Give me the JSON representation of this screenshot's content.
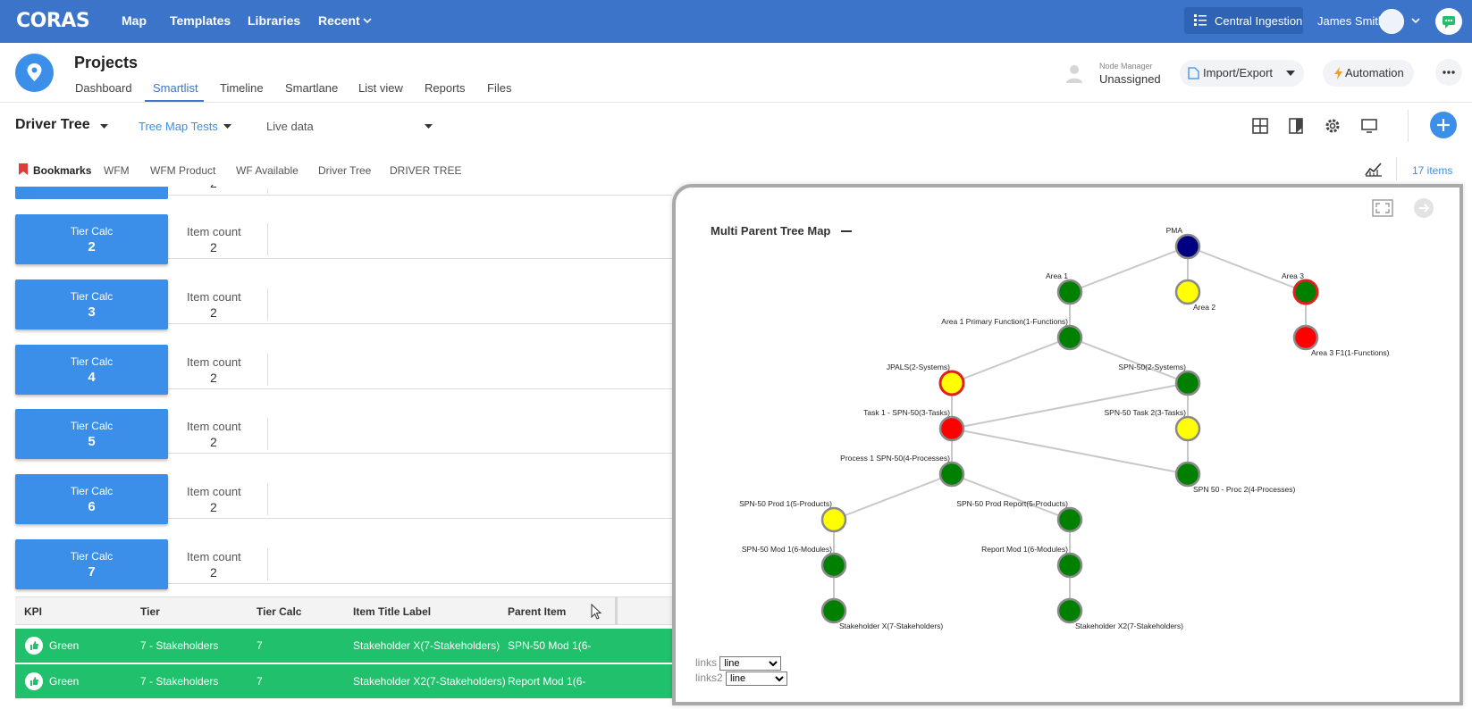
{
  "topbar": {
    "logo": "CORAS",
    "nav": [
      "Map",
      "Templates",
      "Libraries",
      "Recent"
    ],
    "central": "Central Ingestion",
    "user": "James Smith"
  },
  "project": {
    "title": "Projects",
    "tabs": [
      "Dashboard",
      "Smartlist",
      "Timeline",
      "Smartlane",
      "List view",
      "Reports",
      "Files"
    ],
    "active_tab": "Smartlist",
    "node_manager_label": "Node Manager",
    "node_manager_value": "Unassigned",
    "import_export": "Import/Export",
    "automation": "Automation"
  },
  "toolbar": {
    "view": "Driver Tree",
    "filter": "Tree Map Tests",
    "data_mode": "Live data"
  },
  "bookmarks": {
    "label": "Bookmarks",
    "items": [
      "WFM",
      "WFM Product",
      "WF Available",
      "Driver Tree",
      "DRIVER TREE"
    ],
    "count": "17 items"
  },
  "tiers": [
    {
      "label": "Tier Calc",
      "value": "2",
      "count_label": "Item count",
      "count": "2"
    },
    {
      "label": "Tier Calc",
      "value": "3",
      "count_label": "Item count",
      "count": "2"
    },
    {
      "label": "Tier Calc",
      "value": "4",
      "count_label": "Item count",
      "count": "2"
    },
    {
      "label": "Tier Calc",
      "value": "5",
      "count_label": "Item count",
      "count": "2"
    },
    {
      "label": "Tier Calc",
      "value": "6",
      "count_label": "Item count",
      "count": "2"
    },
    {
      "label": "Tier Calc",
      "value": "7",
      "count_label": "Item count",
      "count": "2"
    }
  ],
  "partial_tier_count": "2",
  "table": {
    "headers": [
      "KPI",
      "Tier",
      "Tier Calc",
      "Item Title Label",
      "Parent Item"
    ],
    "rows": [
      [
        "Green",
        "7 - Stakeholders",
        "7",
        "Stakeholder X(7-Stakeholders)",
        "SPN-50 Mod 1(6-"
      ],
      [
        "Green",
        "7 - Stakeholders",
        "7",
        "Stakeholder X2(7-Stakeholders)",
        "Report Mod 1(6-"
      ]
    ],
    "row_color": "#21c06c"
  },
  "popup": {
    "title": "Multi Parent Tree Map",
    "links_label": "links",
    "links2_label": "links2",
    "links_options": [
      "line"
    ],
    "links_value": "line",
    "links2_value": "line"
  },
  "tree": {
    "colors": {
      "navy": "#000080",
      "green": "#008000",
      "yellow": "#ffff00",
      "red": "#ff0000"
    },
    "nodes": [
      {
        "id": "pma",
        "label": "PMA",
        "color": "navy",
        "ring": "grey"
      },
      {
        "id": "a1",
        "label": "Area 1",
        "color": "green",
        "ring": "grey"
      },
      {
        "id": "a2",
        "label": "Area 2",
        "color": "yellow",
        "ring": "grey"
      },
      {
        "id": "a3",
        "label": "Area 3",
        "color": "green",
        "ring": "red"
      },
      {
        "id": "a1pf",
        "label": "Area 1 Primary Function(1-Functions)",
        "color": "green",
        "ring": "grey"
      },
      {
        "id": "a3f1",
        "label": "Area 3 F1(1-Functions)",
        "color": "red",
        "ring": "grey"
      },
      {
        "id": "jpals",
        "label": "JPALS(2-Systems)",
        "color": "yellow",
        "ring": "red"
      },
      {
        "id": "spn50",
        "label": "SPN-50(2-Systems)",
        "color": "green",
        "ring": "grey"
      },
      {
        "id": "task1",
        "label": "Task 1 - SPN-50(3-Tasks)",
        "color": "red",
        "ring": "grey"
      },
      {
        "id": "task2",
        "label": "SPN-50 Task 2(3-Tasks)",
        "color": "yellow",
        "ring": "grey"
      },
      {
        "id": "proc1",
        "label": "Process 1 SPN-50(4-Processes)",
        "color": "green",
        "ring": "grey"
      },
      {
        "id": "proc2",
        "label": "SPN 50 - Proc 2(4-Processes)",
        "color": "green",
        "ring": "grey"
      },
      {
        "id": "prod1",
        "label": "SPN-50 Prod 1(5-Products)",
        "color": "yellow",
        "ring": "grey"
      },
      {
        "id": "prodr",
        "label": "SPN-50 Prod Report(5-Products)",
        "color": "green",
        "ring": "grey"
      },
      {
        "id": "mod1",
        "label": "SPN-50 Mod 1(6-Modules)",
        "color": "green",
        "ring": "grey"
      },
      {
        "id": "rmod1",
        "label": "Report Mod 1(6-Modules)",
        "color": "green",
        "ring": "grey"
      },
      {
        "id": "shx",
        "label": "Stakeholder X(7-Stakeholders)",
        "color": "green",
        "ring": "grey"
      },
      {
        "id": "shx2",
        "label": "Stakeholder X2(7-Stakeholders)",
        "color": "green",
        "ring": "grey"
      }
    ],
    "links": [
      [
        "pma",
        "a1"
      ],
      [
        "pma",
        "a2"
      ],
      [
        "pma",
        "a3"
      ],
      [
        "a1",
        "a1pf"
      ],
      [
        "a3",
        "a3f1"
      ],
      [
        "a1pf",
        "jpals"
      ],
      [
        "a1pf",
        "spn50"
      ],
      [
        "jpals",
        "task1"
      ],
      [
        "spn50",
        "task1"
      ],
      [
        "spn50",
        "task2"
      ],
      [
        "task1",
        "proc1"
      ],
      [
        "task1",
        "proc2"
      ],
      [
        "task2",
        "proc2"
      ],
      [
        "proc1",
        "prod1"
      ],
      [
        "proc1",
        "prodr"
      ],
      [
        "prod1",
        "mod1"
      ],
      [
        "prodr",
        "rmod1"
      ],
      [
        "mod1",
        "shx"
      ],
      [
        "rmod1",
        "shx2"
      ]
    ]
  }
}
